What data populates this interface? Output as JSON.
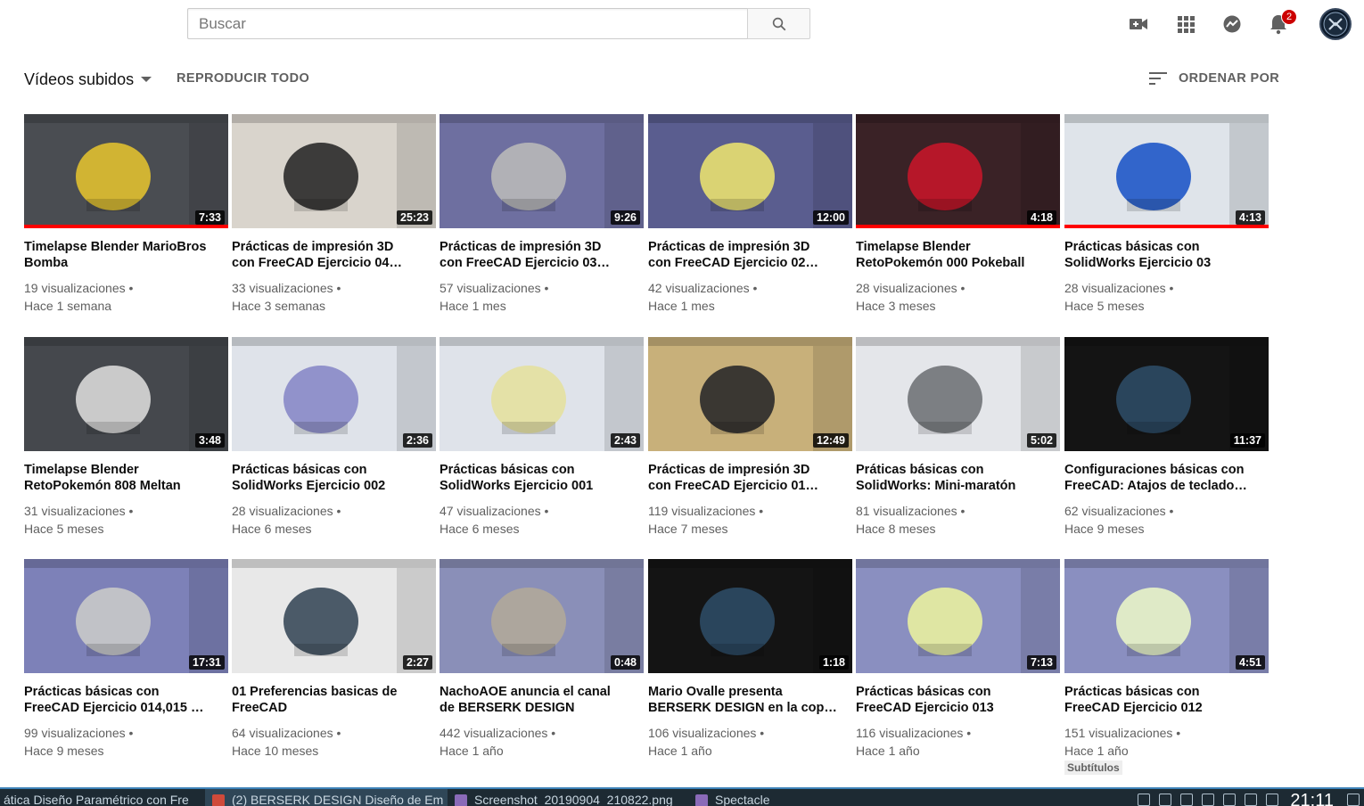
{
  "search": {
    "placeholder": "Buscar"
  },
  "header": {
    "notifications_count": "2"
  },
  "uploads": {
    "title": "Vídeos subidos",
    "play_all": "REPRODUCIR TODO",
    "sort_label": "ORDENAR POR"
  },
  "videos": [
    {
      "title1": "Timelapse Blender MarioBros",
      "title2": "Bomba",
      "views": "19 visualizaciones •",
      "age": "Hace 1 semana",
      "duration": "7:33",
      "watched": 1.0,
      "bg": "#4a4d52",
      "accent": "#e0c030"
    },
    {
      "title1": "Prácticas de impresión 3D",
      "title2": "con FreeCAD Ejercicio 04…",
      "views": "33 visualizaciones •",
      "age": "Hace 3 semanas",
      "duration": "25:23",
      "bg": "#d9d4cc",
      "accent": "#2a2a2a"
    },
    {
      "title1": "Prácticas de impresión 3D",
      "title2": "con FreeCAD Ejercicio 03…",
      "views": "57 visualizaciones •",
      "age": "Hace 1 mes",
      "duration": "9:26",
      "bg": "#6e6fa0",
      "accent": "#b8b8b8"
    },
    {
      "title1": "Prácticas de impresión 3D",
      "title2": "con FreeCAD Ejercicio 02…",
      "views": "42 visualizaciones •",
      "age": "Hace 1 mes",
      "duration": "12:00",
      "bg": "#5a5d8f",
      "accent": "#e8e070"
    },
    {
      "title1": "Timelapse Blender",
      "title2": "RetoPokemón 000 Pokeball",
      "views": "28 visualizaciones •",
      "age": "Hace 3 meses",
      "duration": "4:18",
      "watched": 1.0,
      "bg": "#3a2226",
      "accent": "#c4162a"
    },
    {
      "title1": "Prácticas básicas con",
      "title2": "SolidWorks Ejercicio 03",
      "views": "28 visualizaciones •",
      "age": "Hace 5 meses",
      "duration": "4:13",
      "watched": 1.0,
      "bg": "#dfe4ea",
      "accent": "#1f57c8"
    },
    {
      "title1": "Timelapse Blender",
      "title2": "RetoPokemón 808 Meltan",
      "views": "31 visualizaciones •",
      "age": "Hace 5 meses",
      "duration": "3:48",
      "bg": "#45484d",
      "accent": "#d8d8d8"
    },
    {
      "title1": "Prácticas básicas con",
      "title2": "SolidWorks Ejercicio 002",
      "views": "28 visualizaciones •",
      "age": "Hace 6 meses",
      "duration": "2:36",
      "bg": "#dfe3ea",
      "accent": "#8888c8"
    },
    {
      "title1": "Prácticas básicas con",
      "title2": "SolidWorks Ejercicio 001",
      "views": "47 visualizaciones •",
      "age": "Hace 6 meses",
      "duration": "2:43",
      "bg": "#dfe3ea",
      "accent": "#e4e0a0"
    },
    {
      "title1": "Prácticas de impresión 3D",
      "title2": "con FreeCAD Ejercicio 01…",
      "views": "119 visualizaciones •",
      "age": "Hace 7 meses",
      "duration": "12:49",
      "bg": "#c8b07a",
      "accent": "#2a2a2a"
    },
    {
      "title1": "Práticas básicas con",
      "title2": "SolidWorks: Mini-maratón",
      "views": "81 visualizaciones •",
      "age": "Hace 8 meses",
      "duration": "5:02",
      "bg": "#e4e6ea",
      "accent": "#707378"
    },
    {
      "title1": "Configuraciones básicas con",
      "title2": "FreeCAD: Atajos de teclado…",
      "views": "62 visualizaciones •",
      "age": "Hace 9 meses",
      "duration": "11:37",
      "bg": "#141414",
      "accent": "#2c4a64"
    },
    {
      "title1": "Prácticas básicas con",
      "title2": "FreeCAD Ejercicio 014,015 …",
      "views": "99 visualizaciones •",
      "age": "Hace 9 meses",
      "duration": "17:31",
      "bg": "#7d81b8",
      "accent": "#c9c9c9"
    },
    {
      "title1": "01 Preferencias basicas de",
      "title2": "FreeCAD",
      "views": "64 visualizaciones •",
      "age": "Hace 10 meses",
      "duration": "2:27",
      "bg": "#e8e8e8",
      "accent": "#3a4a5a"
    },
    {
      "title1": "NachoAOE anuncia el canal",
      "title2": "de BERSERK DESIGN",
      "views": "442 visualizaciones •",
      "age": "Hace 1 año",
      "duration": "0:48",
      "bg": "#8a8fb8",
      "accent": "#b0a89a"
    },
    {
      "title1": "Mario Ovalle presenta",
      "title2": "BERSERK DESIGN en la cop…",
      "views": "106 visualizaciones •",
      "age": "Hace 1 año",
      "duration": "1:18",
      "bg": "#141414",
      "accent": "#2c4a64"
    },
    {
      "title1": "Prácticas básicas con",
      "title2": "FreeCAD Ejercicio 013",
      "views": "116 visualizaciones •",
      "age": "Hace 1 año",
      "duration": "7:13",
      "bg": "#8a8fc0",
      "accent": "#e8f0a0"
    },
    {
      "title1": "Prácticas básicas con",
      "title2": "FreeCAD Ejercicio 012",
      "views": "151 visualizaciones •",
      "age": "Hace 1 año",
      "duration": "4:51",
      "badge": "Subtítulos",
      "bg": "#8a8fc0",
      "accent": "#e8f4c8"
    }
  ],
  "taskbar": {
    "items": [
      {
        "label": "ática Diseño Paramétrico con Fre",
        "color": "#4a7ab8"
      },
      {
        "label": "(2) BERSERK DESIGN Diseño de Em",
        "color": "#d04a3a"
      },
      {
        "label": "Screenshot_20190904_210822.png",
        "color": "#8a6ab8"
      },
      {
        "label": "Spectacle",
        "color": "#8a6ab8"
      }
    ],
    "clock": "21:11"
  }
}
